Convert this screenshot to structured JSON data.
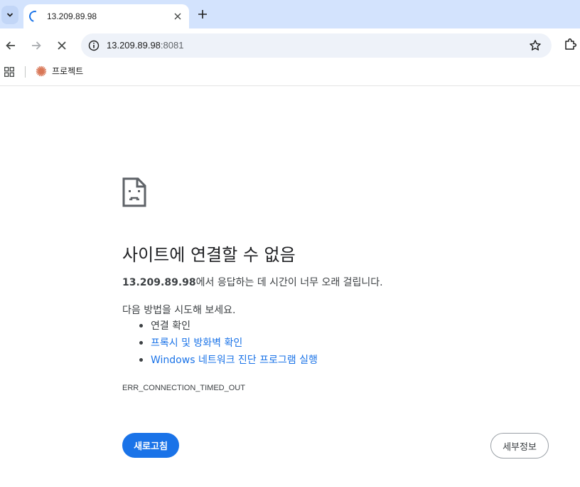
{
  "browser": {
    "tab": {
      "title": "13.209.89.98"
    },
    "omnibox": {
      "host": "13.209.89.98",
      "port": ":8081"
    },
    "bookmarks": [
      {
        "label": "프로젝트"
      }
    ]
  },
  "error_page": {
    "heading": "사이트에 연결할 수 없음",
    "description": {
      "host": "13.209.89.98",
      "message": "에서 응답하는 데 시간이 너무 오래 걸립니다."
    },
    "try_intro": "다음 방법을 시도해 보세요.",
    "suggestions": [
      {
        "text": "연결 확인",
        "link": false
      },
      {
        "text": "프록시 및 방화벽 확인",
        "link": true
      },
      {
        "text": "Windows 네트워크 진단 프로그램 실행",
        "link": true
      }
    ],
    "error_code": "ERR_CONNECTION_TIMED_OUT",
    "buttons": {
      "reload": "새로고침",
      "details": "세부정보"
    }
  },
  "colors": {
    "accent": "#1a73e8",
    "tabstrip": "#d3e3fd",
    "omnibox": "#eef2f9",
    "bookmark_icon": "#d97757"
  },
  "icons": [
    "tab-search-icon",
    "loading-spinner-icon",
    "close-icon",
    "plus-icon",
    "back-arrow-icon",
    "forward-arrow-icon",
    "stop-icon",
    "info-icon",
    "star-icon",
    "extensions-icon",
    "apps-grid-icon",
    "claude-logo-icon",
    "sad-page-icon"
  ]
}
